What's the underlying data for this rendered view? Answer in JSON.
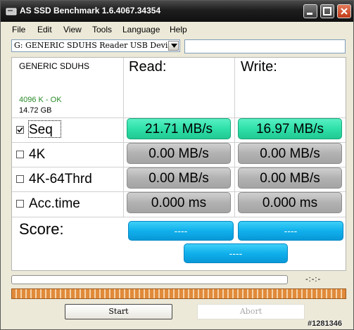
{
  "window": {
    "title": "AS SSD Benchmark 1.6.4067.34354"
  },
  "menu": [
    "File",
    "Edit",
    "View",
    "Tools",
    "Language",
    "Help"
  ],
  "drive": {
    "selected": "G: GENERIC SDUHS Reader USB Device",
    "path_value": ""
  },
  "device": {
    "name": "GENERIC SDUHS",
    "status": "4096 K - OK",
    "size": "14.72 GB"
  },
  "columns": {
    "read": "Read:",
    "write": "Write:"
  },
  "tests": [
    {
      "label": "Seq",
      "checked": true,
      "read": "21.71 MB/s",
      "write": "16.97 MB/s"
    },
    {
      "label": "4K",
      "checked": false,
      "read": "0.00 MB/s",
      "write": "0.00 MB/s"
    },
    {
      "label": "4K-64Thrd",
      "checked": false,
      "read": "0.00 MB/s",
      "write": "0.00 MB/s"
    },
    {
      "label": "Acc.time",
      "checked": false,
      "read": "0.000 ms",
      "write": "0.000 ms"
    }
  ],
  "score": {
    "label": "Score:",
    "read": "----",
    "write": "----",
    "total": "----"
  },
  "progress": {
    "value": 0,
    "time": "-:-:-"
  },
  "buttons": {
    "start": "Start",
    "abort": "Abort"
  },
  "watermark": "#1281346",
  "colors": {
    "result_active": "#2ee0a8",
    "result_inactive": "#b2b2b2",
    "score": "#10b0ec",
    "activity_bar": "#e08a3a"
  }
}
